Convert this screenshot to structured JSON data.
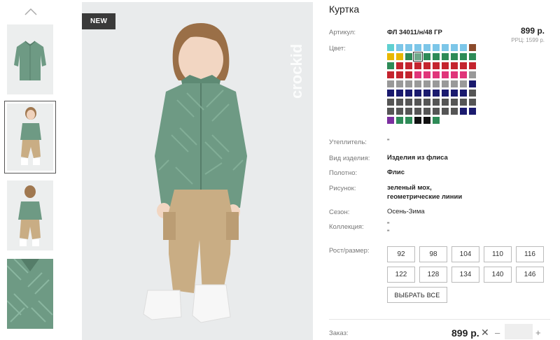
{
  "product": {
    "title": "Куртка",
    "badge": "NEW",
    "brand": "crockid"
  },
  "specs": {
    "article_label": "Артикул:",
    "article_value": "ФЛ 34011/н/48 ГР",
    "color_label": "Цвет:",
    "insulation_label": "Утеплитель:",
    "insulation_value": "\"",
    "type_label": "Вид изделия:",
    "type_value": "Изделия из флиса",
    "fabric_label": "Полотно:",
    "fabric_value": "Флис",
    "pattern_label": "Рисунок:",
    "pattern_line1": "зеленый мох,",
    "pattern_line2": "геометрические линии",
    "season_label": "Сезон:",
    "season_value": "Осень-Зима",
    "collection_label": "Коллекция:",
    "collection_line1": "\"",
    "collection_line2": "\""
  },
  "pricing": {
    "price": "899 р.",
    "rrc": "РРЦ: 1599 р."
  },
  "sizes": {
    "label": "Рост/размер:",
    "values": [
      "92",
      "98",
      "104",
      "110",
      "116",
      "122",
      "128",
      "134",
      "140",
      "146"
    ],
    "select_all": "ВЫБРАТЬ ВСЕ"
  },
  "order": {
    "label": "Заказ:",
    "price": "899 р.",
    "remove_symbol": "✕",
    "minus": "–",
    "plus": "+",
    "quantity": ""
  },
  "colors": {
    "swatches": [
      [
        "#5fd0d0",
        "#7cc6e8",
        "#7cc6e8",
        "#7cc6e8",
        "#7cc6e8",
        "#7cc6e8",
        "#7cc6e8",
        "#7cc6e8",
        "#7cc6e8",
        "#8b4a2b"
      ],
      [
        "#e8b800",
        "#e8b800",
        "#2e8b57",
        "#6fa88a",
        "#2e8b57",
        "#2e8b57",
        "#2e8b57",
        "#2e8b57",
        "#2e8b57",
        "#2e8b57"
      ],
      [
        "#2e8b57",
        "#c4242e",
        "#c4242e",
        "#c4242e",
        "#c4242e",
        "#c4242e",
        "#c4242e",
        "#c4242e",
        "#c4242e",
        "#c4242e"
      ],
      [
        "#c4242e",
        "#c4242e",
        "#c4242e",
        "#e0357a",
        "#e0357a",
        "#e0357a",
        "#e0357a",
        "#e0357a",
        "#e0357a",
        "#999999"
      ],
      [
        "#999999",
        "#999999",
        "#999999",
        "#999999",
        "#999999",
        "#999999",
        "#999999",
        "#999999",
        "#999999",
        "#1a1a6e"
      ],
      [
        "#1a1a6e",
        "#1a1a6e",
        "#1a1a6e",
        "#1a1a6e",
        "#1a1a6e",
        "#1a1a6e",
        "#1a1a6e",
        "#1a1a6e",
        "#1a1a6e",
        "#555555"
      ],
      [
        "#555555",
        "#555555",
        "#555555",
        "#555555",
        "#555555",
        "#555555",
        "#555555",
        "#555555",
        "#555555",
        "#555555"
      ],
      [
        "#555555",
        "#555555",
        "#555555",
        "#555555",
        "#555555",
        "#555555",
        "#555555",
        "#555555",
        "#1a1a6e",
        "#1a1a6e"
      ],
      [
        "#7b2fa0",
        "#2e8b57",
        "#2e8b57",
        "#111111",
        "#111111",
        "#2e8b57"
      ]
    ],
    "selected": "#6fa88a"
  },
  "icons": {
    "thumb_up": "chevron-up-icon"
  }
}
